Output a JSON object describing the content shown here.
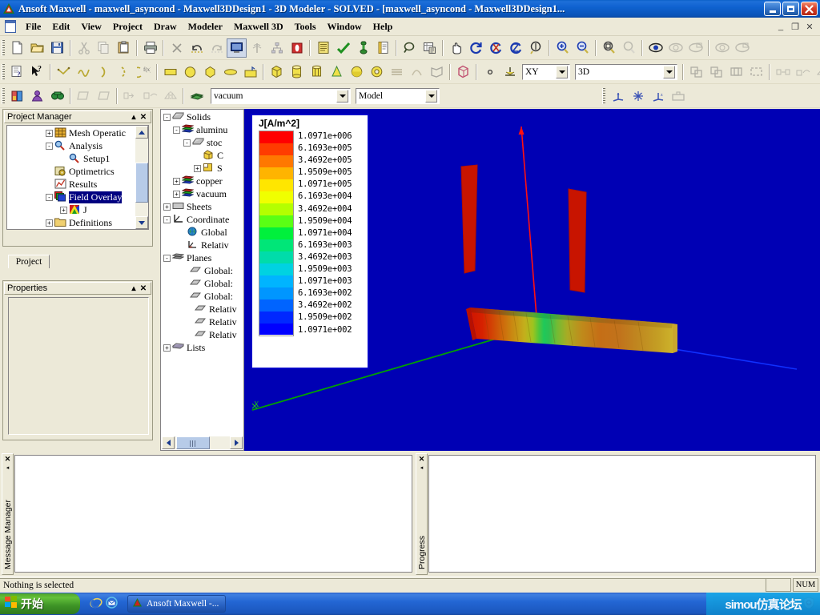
{
  "window": {
    "title": "Ansoft Maxwell - maxwell_asy<x>cond - Maxwell3DDesign1 - 3D Modeler - SOLVED - [maxwell_asy<x>cond - Maxwell3DDesign1...",
    "title_text": "Ansoft Maxwell - maxwell_asyncond - Maxwell3DDesign1 - 3D Modeler - SOLVED - [maxwell_asyncond - Maxwell3DDesign1...",
    "minimize": "_",
    "maximize": "❐",
    "close": "✕",
    "mdi_minimize": "_",
    "mdi_restore": "❐",
    "mdi_close": "✕"
  },
  "menu": {
    "items": [
      {
        "label": "File"
      },
      {
        "label": "Edit"
      },
      {
        "label": "View"
      },
      {
        "label": "Project"
      },
      {
        "label": "Draw"
      },
      {
        "label": "Modeler"
      },
      {
        "label": "Maxwell 3D"
      },
      {
        "label": "Tools"
      },
      {
        "label": "Window"
      },
      {
        "label": "Help"
      }
    ]
  },
  "toolbars": {
    "row1_icons": [
      "new-document-icon",
      "open-folder-icon",
      "save-icon",
      "cut-icon",
      "copy-icon",
      "paste-icon",
      "print-icon",
      "delete-icon",
      "undo-icon",
      "redo-icon",
      "desktop-view-icon",
      "antenna-icon",
      "network-icon",
      "validate-icon",
      "report-icon",
      "check-analyze-icon",
      "excitation-icon",
      "notes-icon",
      "search-field-icon",
      "spreadsheet-icon",
      "pan-icon",
      "rotate-icon",
      "rotate-x-icon",
      "rotate-z-icon",
      "dynamic-rotate-icon",
      "zoom-in-icon",
      "zoom-out-icon",
      "fit-all-icon",
      "fit-selection-icon",
      "eye-visibility-icon",
      "hide-object-icon",
      "hide-all-icon",
      "show-object-icon",
      "show-all-icon"
    ],
    "row2_icons": [
      "context-help-icon",
      "whats-this-icon",
      "draw-line-icon",
      "draw-spline-icon",
      "draw-arc-center-icon",
      "draw-arc-3point-icon",
      "draw-equation-icon",
      "draw-rectangle-icon",
      "draw-circle-icon",
      "draw-regular-polygon-icon",
      "draw-ellipse-icon",
      "draw-plane-icon",
      "draw-box-icon",
      "draw-cylinder-icon",
      "draw-regular-polyhedron-icon",
      "draw-cone-icon",
      "draw-sphere-icon",
      "draw-torus-icon",
      "draw-helix-icon",
      "draw-bondwire-icon",
      "draw-section-icon",
      "draw-user-defined-icon",
      "draw-point-icon",
      "draw-3d-polyline-icon",
      "unite-icon",
      "subtract-icon",
      "intersect-icon",
      "split-icon",
      "move-icon",
      "duplicate-around-axis-icon",
      "mirror-icon"
    ],
    "row3_icons": [
      "material-icon",
      "boundary-icon",
      "field-overlay-icon",
      "assign-face-icon",
      "assign-object-icon",
      "move-face-icon",
      "duplicate-mirror-icon",
      "scale-icon",
      "sweep-icon",
      "axes-icon",
      "grid-icon",
      "origin-icon",
      "plane-icon"
    ],
    "plane_select": "XY",
    "mode_select": "3D",
    "material_select": "vacuum",
    "model_select": "Model"
  },
  "project_manager": {
    "title": "Project Manager",
    "collapse": "▴",
    "close": "✕",
    "tab": "Project",
    "tree": [
      {
        "label": "Mesh Operatic",
        "toggle": "+",
        "indent": 2,
        "icon": "mesh-operations-icon"
      },
      {
        "label": "Analysis",
        "toggle": "-",
        "indent": 2,
        "icon": "analysis-icon"
      },
      {
        "label": "Setup1",
        "toggle": "",
        "indent": 3,
        "icon": "setup-icon"
      },
      {
        "label": "Optimetrics",
        "toggle": "",
        "indent": 2,
        "icon": "optimetrics-icon"
      },
      {
        "label": "Results",
        "toggle": "",
        "indent": 2,
        "icon": "results-icon"
      },
      {
        "label": "Field Overlay",
        "toggle": "-",
        "indent": 2,
        "icon": "field-overlays-icon",
        "selected": true
      },
      {
        "label": "J",
        "toggle": "+",
        "indent": 3,
        "icon": "j-field-icon"
      },
      {
        "label": "Definitions",
        "toggle": "+",
        "indent": 2,
        "icon": "definitions-folder-icon"
      }
    ]
  },
  "properties": {
    "title": "Properties",
    "collapse": "▴",
    "close": "✕"
  },
  "model_tree": {
    "items": [
      {
        "label": "Solids",
        "toggle": "-",
        "indent": 0,
        "icon": "solids-icon"
      },
      {
        "label": "aluminu",
        "toggle": "-",
        "indent": 1,
        "icon": "material-stack-icon"
      },
      {
        "label": "stoc",
        "toggle": "-",
        "indent": 2,
        "icon": "solid-object-icon"
      },
      {
        "label": "C",
        "toggle": "",
        "indent": 3,
        "icon": "createbox-icon"
      },
      {
        "label": "S",
        "toggle": "+",
        "indent": 3,
        "icon": "section-icon"
      },
      {
        "label": "copper",
        "toggle": "+",
        "indent": 1,
        "icon": "material-stack-icon"
      },
      {
        "label": "vacuum",
        "toggle": "+",
        "indent": 1,
        "icon": "material-stack-icon"
      },
      {
        "label": "Sheets",
        "toggle": "+",
        "indent": 0,
        "icon": "sheets-icon"
      },
      {
        "label": "Coordinate",
        "toggle": "-",
        "indent": 0,
        "icon": "coordinate-systems-icon"
      },
      {
        "label": "Global",
        "toggle": "",
        "indent": 1,
        "icon": "global-cs-icon"
      },
      {
        "label": "Relativ",
        "toggle": "",
        "indent": 1,
        "icon": "relative-cs-icon"
      },
      {
        "label": "Planes",
        "toggle": "-",
        "indent": 0,
        "icon": "planes-icon"
      },
      {
        "label": "Global:",
        "toggle": "",
        "indent": 1,
        "icon": "plane-icon"
      },
      {
        "label": "Global:",
        "toggle": "",
        "indent": 1,
        "icon": "plane-icon"
      },
      {
        "label": "Global:",
        "toggle": "",
        "indent": 1,
        "icon": "plane-icon"
      },
      {
        "label": "Relativ",
        "toggle": "",
        "indent": 1,
        "icon": "plane-icon"
      },
      {
        "label": "Relativ",
        "toggle": "",
        "indent": 1,
        "icon": "plane-icon"
      },
      {
        "label": "Relativ",
        "toggle": "",
        "indent": 1,
        "icon": "plane-icon"
      },
      {
        "label": "Lists",
        "toggle": "+",
        "indent": 0,
        "icon": "lists-icon"
      }
    ]
  },
  "chart_data": {
    "type": "heatmap",
    "title": "J[A/m^2]",
    "legend_position": "top-left-overlay",
    "scale": "log",
    "unit": "A/m^2",
    "tick_labels": [
      "1.0971e+006",
      "6.1693e+005",
      "3.4692e+005",
      "1.9509e+005",
      "1.0971e+005",
      "6.1693e+004",
      "3.4692e+004",
      "1.9509e+004",
      "1.0971e+004",
      "6.1693e+003",
      "3.4692e+003",
      "1.9509e+003",
      "1.0971e+003",
      "6.1693e+002",
      "3.4692e+002",
      "1.9509e+002",
      "1.0971e+002"
    ],
    "values": [
      1097100,
      616930,
      346920,
      195090,
      109710,
      61693,
      34692,
      19509,
      10971,
      6169.3,
      3469.2,
      1950.9,
      1097.1,
      616.93,
      346.92,
      195.09,
      109.71
    ],
    "colors": [
      "#ff0000",
      "#ff3c00",
      "#ff7800",
      "#ffb400",
      "#ffe600",
      "#f0ff00",
      "#b4ff00",
      "#5aff14",
      "#00f03c",
      "#00e678",
      "#00dcaa",
      "#00d2e1",
      "#00b4ff",
      "#0096ff",
      "#0064ff",
      "#0028ff",
      "#0000ff"
    ],
    "xlabel": "",
    "ylabel": "",
    "background": "#0000b4"
  },
  "viewport": {
    "axis_label_x": "X",
    "background_color": "#0000b4",
    "z_axis_color": "#ff0000",
    "x_axis_color": "#00a000",
    "y_axis_color": "#0040ff"
  },
  "message_manager": {
    "label": "Message Manager",
    "close": "✕",
    "collapse": "◂"
  },
  "progress": {
    "label": "Progress",
    "close": "✕",
    "collapse": "◂"
  },
  "status_bar": {
    "message": "Nothing is selected",
    "cell1": "",
    "num": "NUM"
  },
  "taskbar": {
    "start_label": "开始",
    "quick_launch": [
      "internet-explorer-icon",
      "outlook-express-icon"
    ],
    "task_item": "Ansoft Maxwell -...",
    "tray_icons": [
      "keyboard-ime-icon",
      "antivirus-shield-icon"
    ],
    "watermark_text": "simou仿真论坛"
  }
}
